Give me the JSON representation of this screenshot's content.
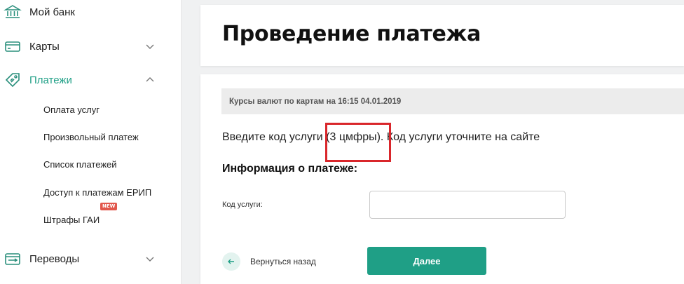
{
  "sidebar": {
    "items": [
      {
        "label": "Мой банк",
        "icon": "bank-icon"
      },
      {
        "label": "Карты",
        "icon": "card-icon"
      },
      {
        "label": "Платежи",
        "icon": "tag-icon"
      },
      {
        "label": "Переводы",
        "icon": "transfer-icon"
      }
    ],
    "payment_subitems": [
      {
        "label": "Оплата услуг"
      },
      {
        "label": "Произвольный платеж"
      },
      {
        "label": "Список платежей"
      },
      {
        "label": "Доступ к платежам ЕРИП"
      },
      {
        "label": "Штрафы ГАИ",
        "badge": "NEW"
      }
    ]
  },
  "header": {
    "title": "Проведение платежа"
  },
  "main": {
    "rates_text": "Курсы валют по картам на 16:15 04.01.2019",
    "instruction": "Введите код услуги (3 цмфры). Код услуги уточните на сайте",
    "section_heading": "Информация о платеже:",
    "field_label": "Код услуги:",
    "field_value": "",
    "back_label": "Вернуться назад",
    "next_label": "Далее"
  },
  "colors": {
    "accent": "#1f9f86",
    "highlight": "#d9262b",
    "badge": "#e2574c"
  }
}
